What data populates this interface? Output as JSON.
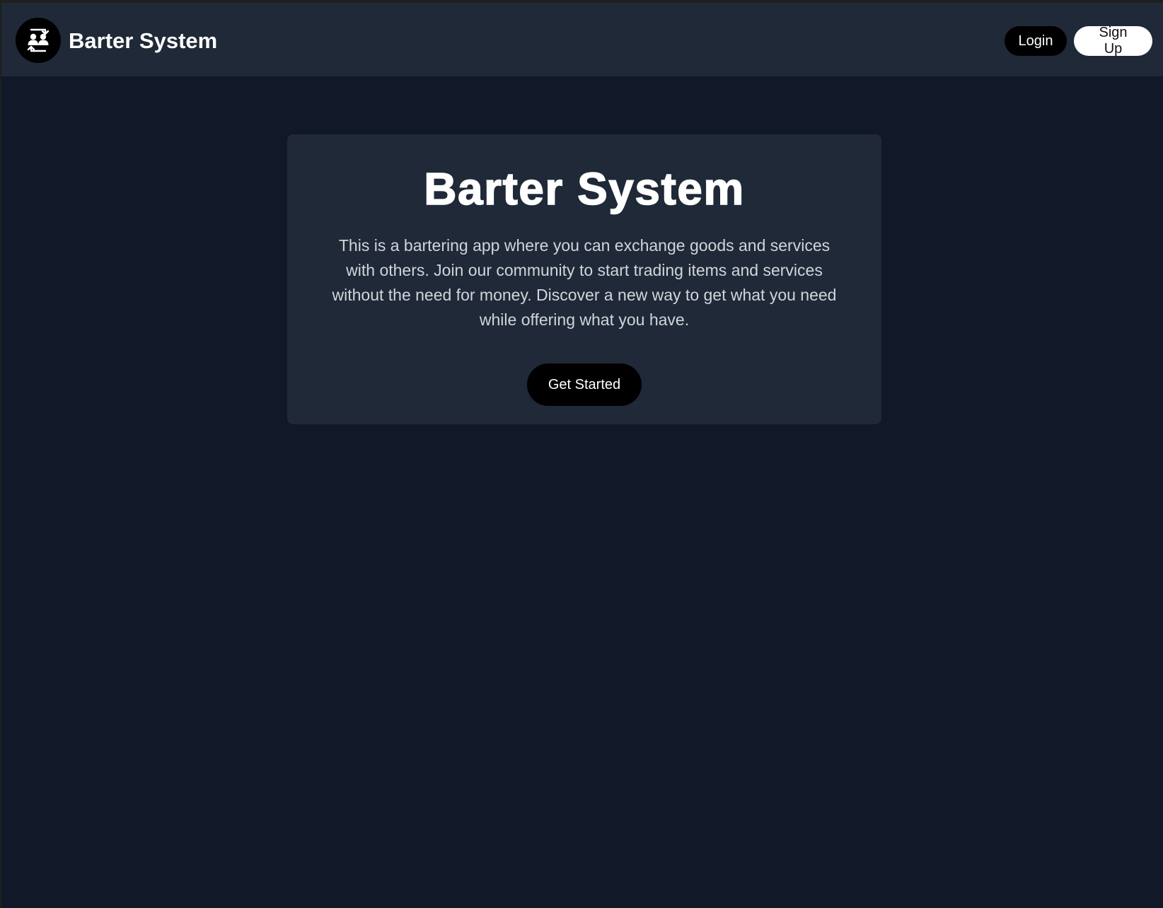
{
  "header": {
    "brand_name": "Barter System",
    "logo_icon": "users-exchange-icon",
    "login_label": "Login",
    "signup_label": "Sign Up"
  },
  "hero": {
    "title": "Barter System",
    "description": "This is a bartering app where you can exchange goods and services with others. Join our community to start trading items and services without the need for money. Discover a new way to get what you need while offering what you have.",
    "cta_label": "Get Started"
  },
  "colors": {
    "page_background": "#111827",
    "panel_background": "#1f2937",
    "primary_button": "#000000",
    "secondary_button": "#ffffff",
    "text_primary": "#ffffff",
    "text_secondary": "#d1d5db"
  }
}
